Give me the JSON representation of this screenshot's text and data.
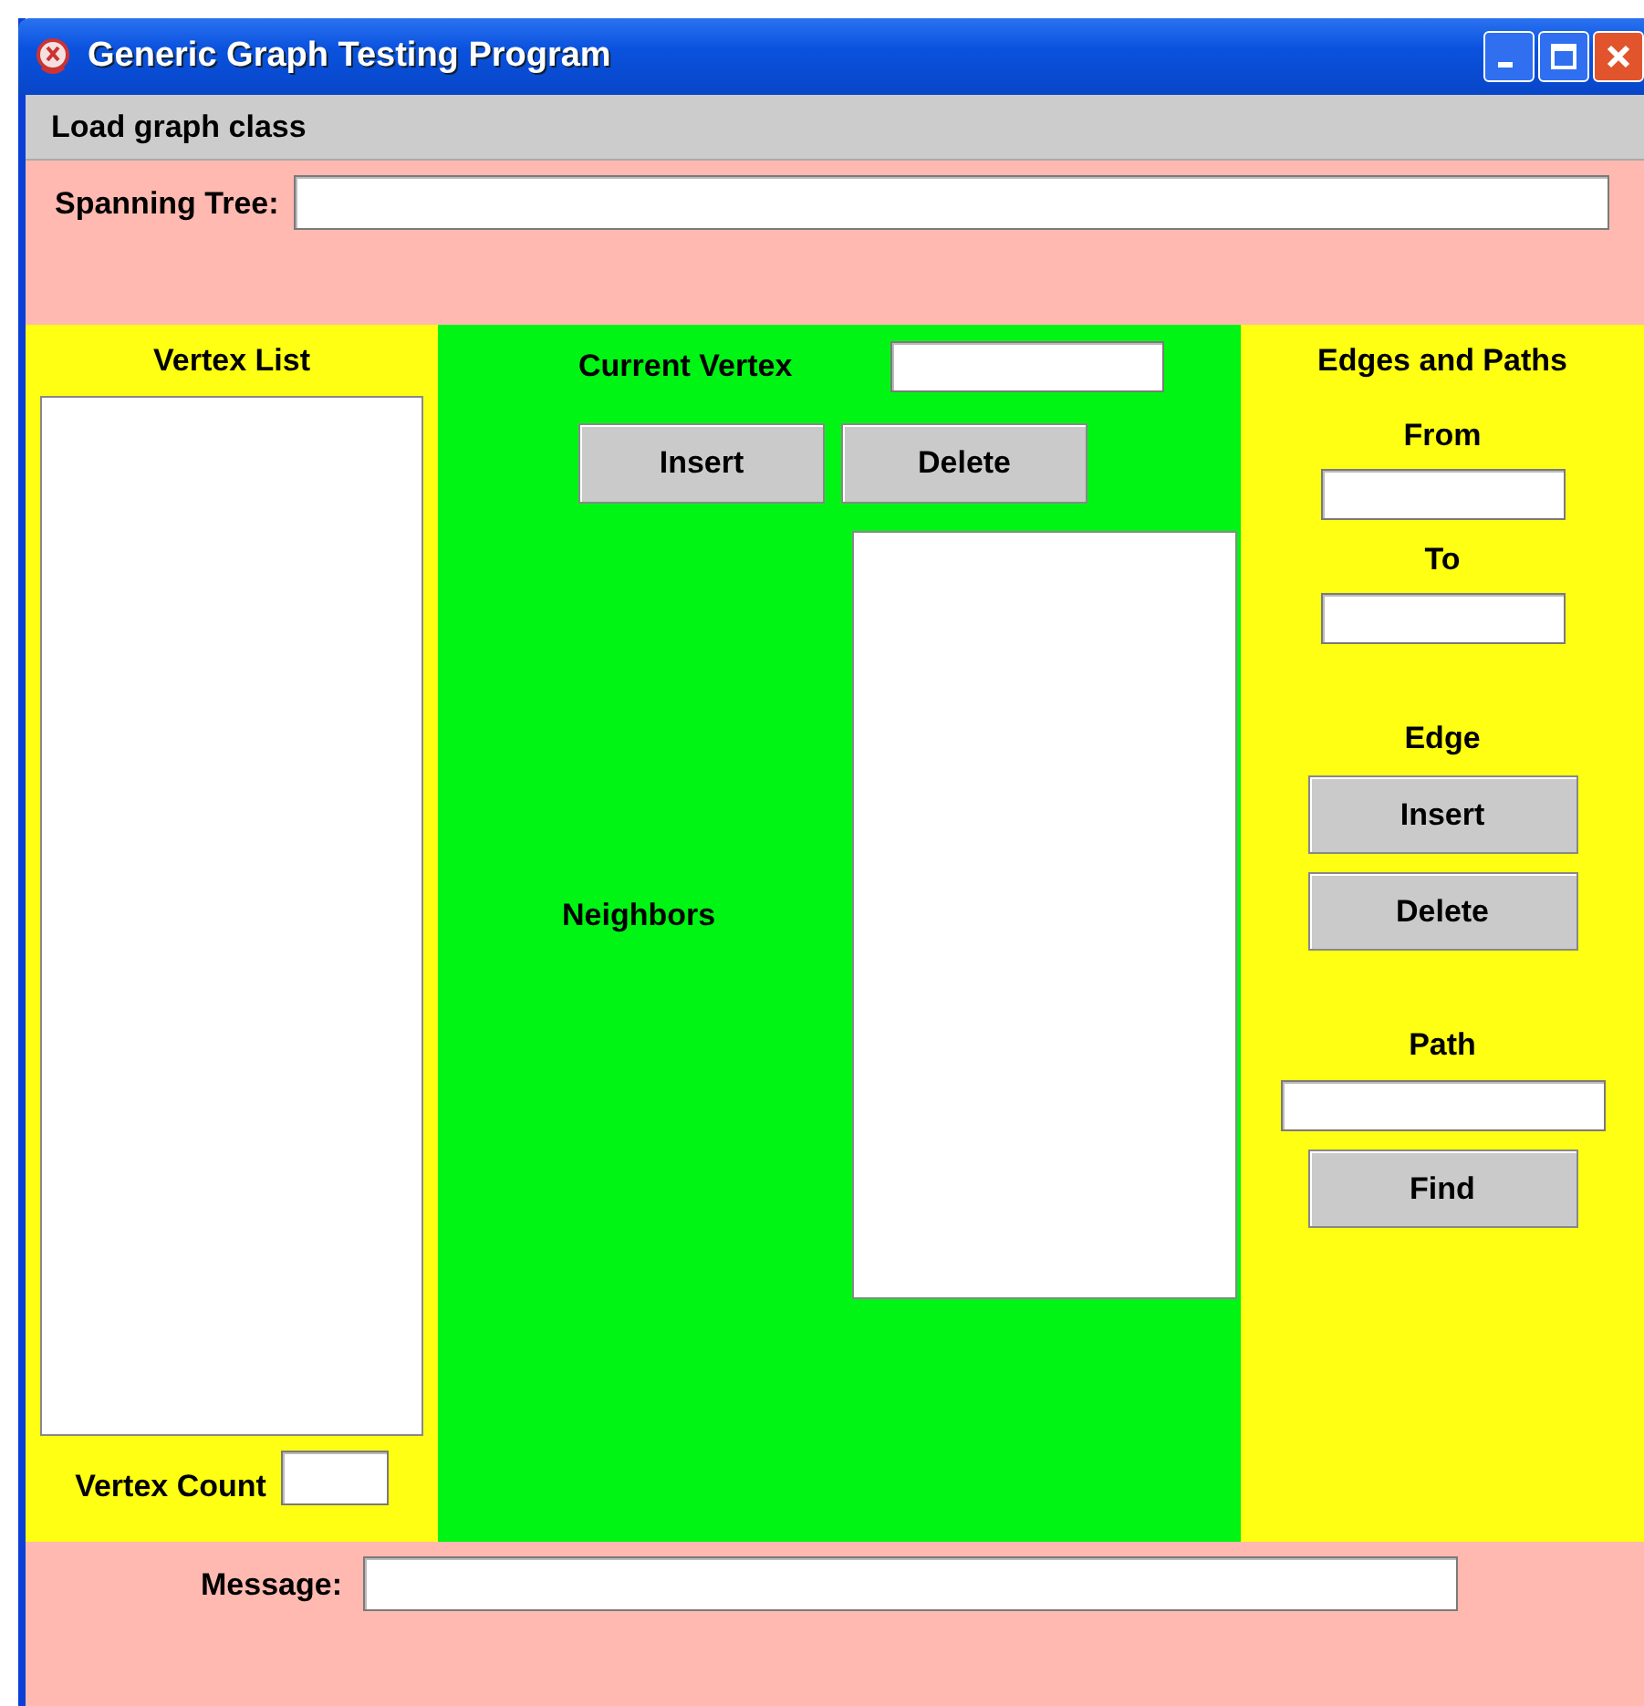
{
  "window": {
    "title": "Generic Graph Testing Program"
  },
  "menu_bar": {
    "items": [
      {
        "label": "Load graph class"
      }
    ]
  },
  "spanning_tree": {
    "label": "Spanning Tree:"
  },
  "vertex_list": {
    "title": "Vertex List",
    "count_label": "Vertex Count"
  },
  "current_vertex": {
    "label": "Current Vertex",
    "buttons": [
      "Insert",
      "Delete"
    ],
    "neighbors_label": "Neighbors"
  },
  "edges_and_paths": {
    "title": "Edges and Paths",
    "from_label": "From",
    "to_label": "To",
    "edge_label": "Edge",
    "edge_buttons": [
      "Insert",
      "Delete"
    ],
    "path_label": "Path",
    "path_button": "Find"
  },
  "message": {
    "label": "Message:"
  }
}
